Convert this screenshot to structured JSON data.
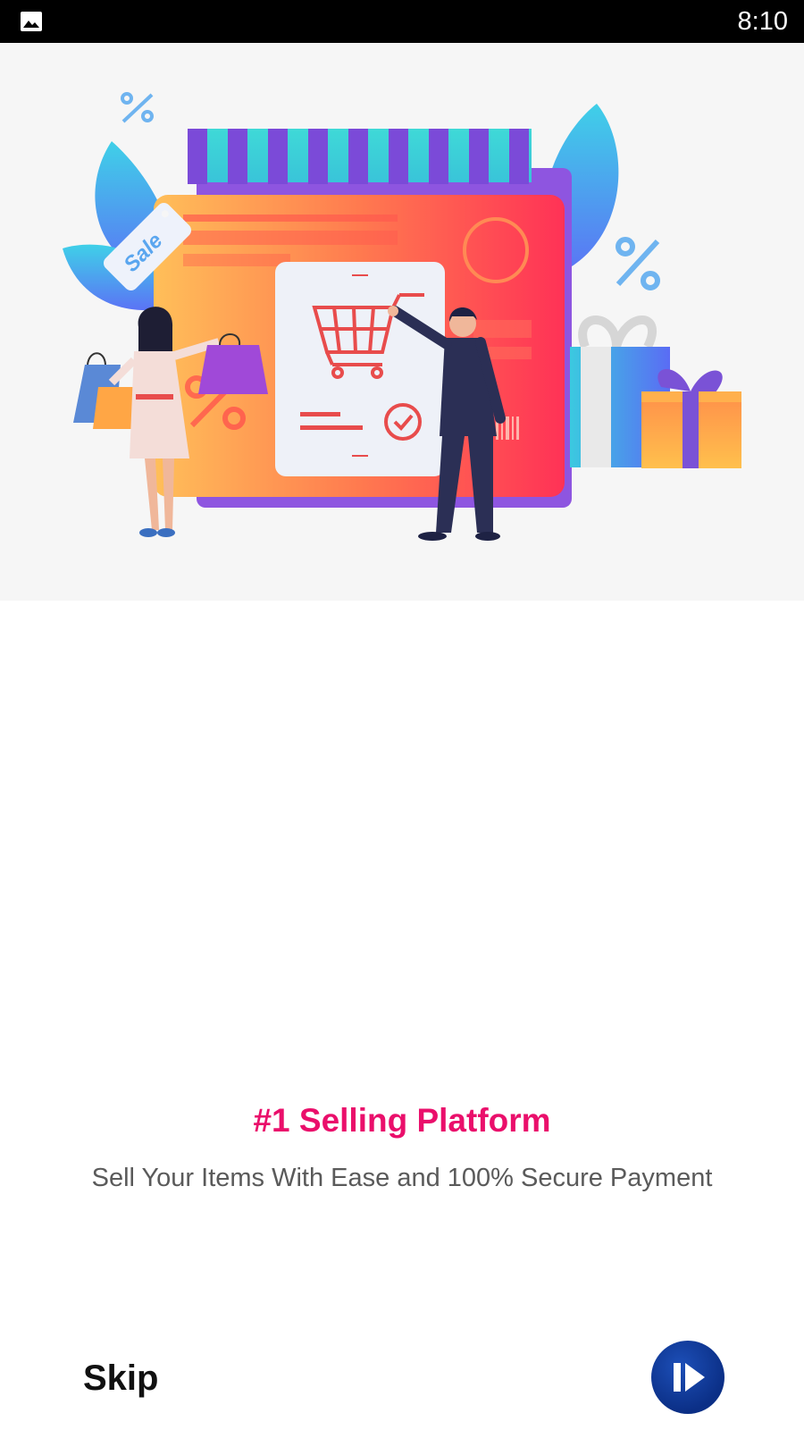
{
  "status_bar": {
    "time": "8:10",
    "left_icon": "image-gallery-icon"
  },
  "hero": {
    "sale_tag": "Sale",
    "illustration_icons": [
      "percent-icon",
      "shopping-cart-icon",
      "checkmark-icon",
      "gift-box-icon",
      "shopping-bag-icon"
    ]
  },
  "onboarding": {
    "title": "#1 Selling Platform",
    "subtitle": "Sell Your Items With Ease and 100% Secure Payment",
    "skip_label": "Skip",
    "next_icon": "next-play-icon"
  },
  "colors": {
    "accent_title": "#ea0f6b",
    "button_bg": "#0b2f86",
    "subtitle_text": "#5a5a5a"
  }
}
